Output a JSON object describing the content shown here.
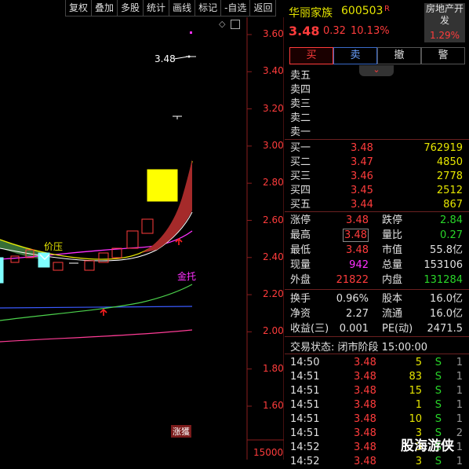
{
  "toolbar": [
    "复权",
    "叠加",
    "多股",
    "统计",
    "画线",
    "标记",
    "-自选",
    "返回"
  ],
  "chart": {
    "y_ticks": [
      "3.60",
      "3.40",
      "3.20",
      "3.00",
      "2.80",
      "2.60",
      "2.40",
      "2.20",
      "2.00",
      "1.80",
      "1.60"
    ],
    "bottom_value": "15000",
    "label_last_price": "3.48",
    "label_pressure": "价压",
    "label_support": "金托",
    "label_limit": "涨獲",
    "diamond": "◇",
    "ma_colors": {
      "white": "#ffffff",
      "yellow": "#e6e600",
      "magenta": "#ff30ff",
      "green": "#4cd24c",
      "blue": "#3a5aff",
      "pink": "#ff3c96"
    }
  },
  "quote": {
    "name": "华丽家族",
    "code": "600503",
    "badge": "R",
    "sector": "房地产开发",
    "sector_change": "1.29%",
    "price": "3.48",
    "change": "0.32",
    "change_pct": "10.13%"
  },
  "buttons": {
    "buy": "买",
    "sell": "卖",
    "cancel": "撤",
    "alert": "警"
  },
  "expand_icon": "⌄",
  "sell_levels": [
    "卖五",
    "卖四",
    "卖三",
    "卖二",
    "卖一"
  ],
  "buy_levels": [
    {
      "label": "买一",
      "price": "3.48",
      "vol": "762919"
    },
    {
      "label": "买二",
      "price": "3.47",
      "vol": "4850"
    },
    {
      "label": "买三",
      "price": "3.46",
      "vol": "2778"
    },
    {
      "label": "买四",
      "price": "3.45",
      "vol": "2512"
    },
    {
      "label": "买五",
      "price": "3.44",
      "vol": "867"
    }
  ],
  "stats": {
    "zt_label": "涨停",
    "zt": "3.48",
    "dt_label": "跌停",
    "dt": "2.84",
    "high_label": "最高",
    "high": "3.48",
    "lb_label": "量比",
    "lb": "0.27",
    "low_label": "最低",
    "low": "3.48",
    "mv_label": "市值",
    "mv": "55.8亿",
    "now_label": "现量",
    "now": "942",
    "tv_label": "总量",
    "tv": "153106",
    "out_label": "外盘",
    "out": "21822",
    "in_label": "内盘",
    "in": "131284",
    "hs_label": "换手",
    "hs": "0.96%",
    "gb_label": "股本",
    "gb": "16.0亿",
    "jz_label": "净资",
    "jz": "2.27",
    "lt_label": "流通",
    "lt": "16.0亿",
    "sy_label": "收益(三)",
    "sy": "0.001",
    "pe_label": "PE(动)",
    "pe": "2471.5"
  },
  "trade_status": "交易状态: 闭市阶段 15:00:00",
  "ticks": [
    {
      "t": "14:50",
      "p": "3.48",
      "v": "5",
      "d": "S",
      "n": "1"
    },
    {
      "t": "14:51",
      "p": "3.48",
      "v": "83",
      "d": "S",
      "n": "1"
    },
    {
      "t": "14:51",
      "p": "3.48",
      "v": "15",
      "d": "S",
      "n": "1"
    },
    {
      "t": "14:51",
      "p": "3.48",
      "v": "1",
      "d": "S",
      "n": "1"
    },
    {
      "t": "14:51",
      "p": "3.48",
      "v": "10",
      "d": "S",
      "n": "1"
    },
    {
      "t": "14:51",
      "p": "3.48",
      "v": "3",
      "d": "S",
      "n": "2"
    },
    {
      "t": "14:52",
      "p": "3.48",
      "v": "3",
      "d": "S",
      "n": "1"
    },
    {
      "t": "14:52",
      "p": "3.48",
      "v": "3",
      "d": "S",
      "n": "1"
    }
  ],
  "watermark": "股海游侠"
}
